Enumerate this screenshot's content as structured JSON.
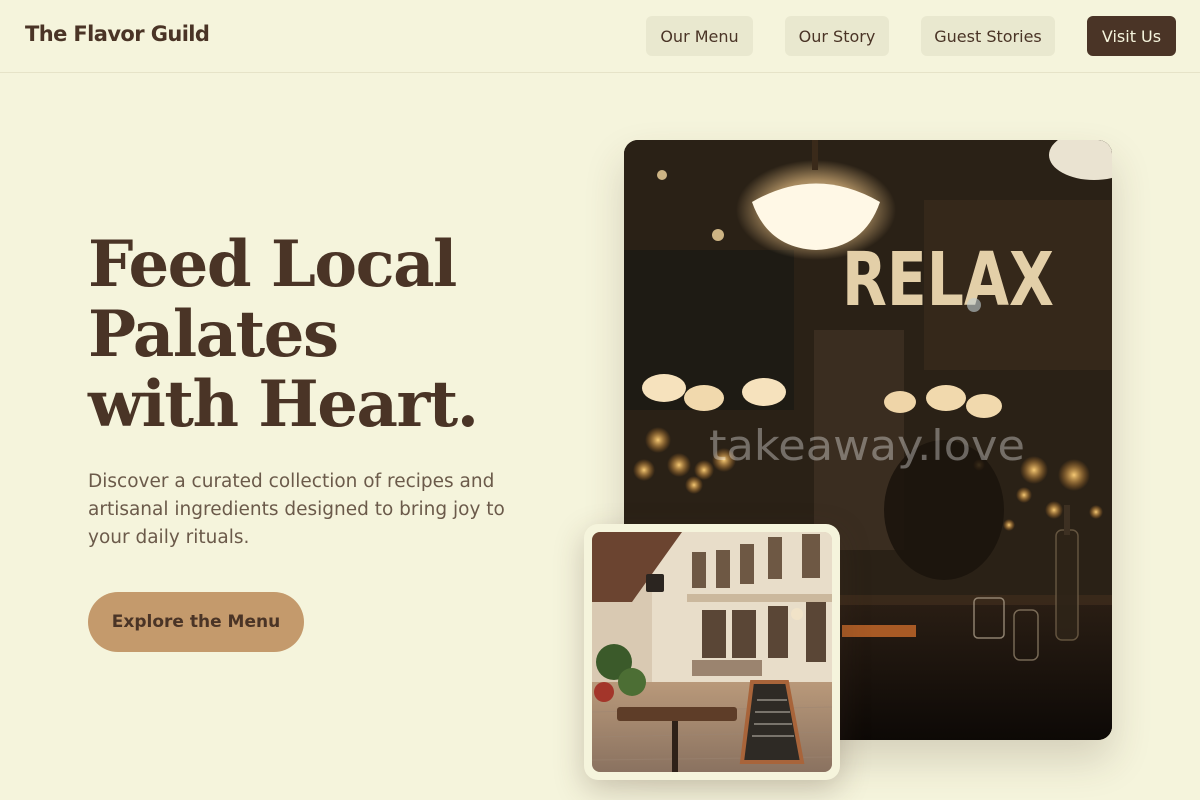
{
  "header": {
    "brand": "The Flavor Guild",
    "nav": [
      {
        "label": "Our Menu"
      },
      {
        "label": "Our Story"
      },
      {
        "label": "Guest Stories"
      }
    ],
    "cta_label": "Visit Us"
  },
  "hero": {
    "title_lines": [
      "Feed Local",
      "Palates",
      "with Heart."
    ],
    "description": "Discover a curated collection of recipes and artisanal ingredients designed to bring joy to your daily rituals.",
    "button_label": "Explore the Menu"
  },
  "images": {
    "main": {
      "sign_text": "RELAX",
      "watermark": "takeaway.love"
    },
    "secondary": {}
  },
  "colors": {
    "background": "#f5f4dc",
    "primary_dark": "#4a3426",
    "accent": "#c49a6c",
    "nav_button_bg": "#e9e8cf"
  }
}
